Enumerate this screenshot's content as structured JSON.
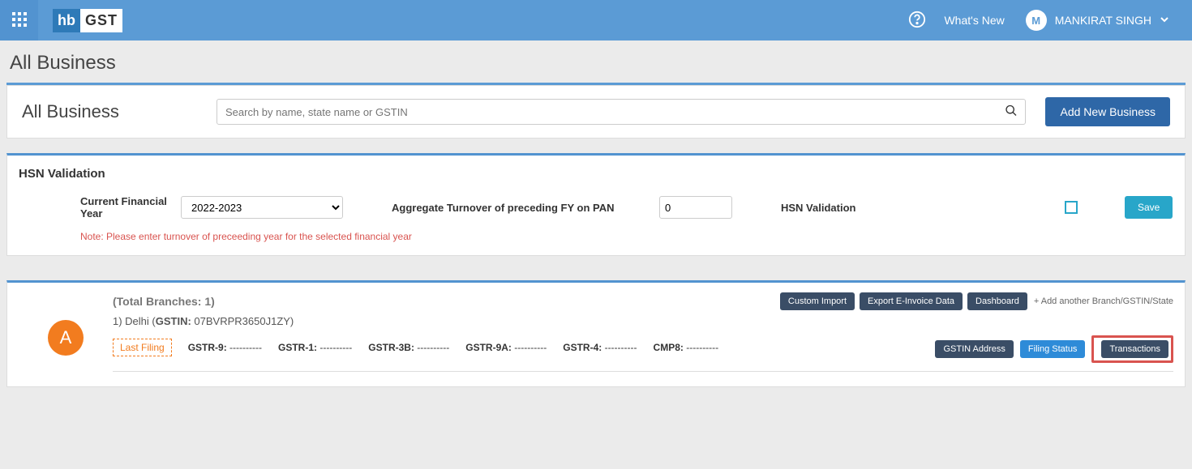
{
  "topbar": {
    "logo_hb": "hb",
    "logo_gst": "GST",
    "whats_new": "What's New",
    "user_initial": "M",
    "user_name": "MANKIRAT SINGH"
  },
  "page": {
    "title": "All Business"
  },
  "business_bar": {
    "label": "All Business",
    "search_placeholder": "Search by name, state name or GSTIN",
    "add_button": "Add New Business"
  },
  "hsn": {
    "title": "HSN Validation",
    "fy_label": "Current Financial Year",
    "fy_value": "2022-2023",
    "turnover_label": "Aggregate Turnover of preceding FY on PAN",
    "turnover_value": "0",
    "validation_label": "HSN Validation",
    "save_label": "Save",
    "note": "Note: Please enter turnover of preceeding year for the selected financial year"
  },
  "biz": {
    "branches_label": "(Total Branches: 1)",
    "buttons": {
      "custom_import": "Custom Import",
      "export_einvoice": "Export E-Invoice Data",
      "dashboard": "Dashboard",
      "add_branch": "+ Add another Branch/GSTIN/State"
    },
    "avatar_letter": "A",
    "row": {
      "prefix": "1) Delhi (",
      "gstin_label": "GSTIN:",
      "gstin_value": " 07BVRPR3650J1ZY)",
      "last_filing": "Last Filing",
      "filings": {
        "gstr9": {
          "label": "GSTR-9:",
          "value": " ----------"
        },
        "gstr1": {
          "label": "GSTR-1:",
          "value": " ----------"
        },
        "gstr3b": {
          "label": "GSTR-3B:",
          "value": " ----------"
        },
        "gstr9a": {
          "label": "GSTR-9A:",
          "value": " ----------"
        },
        "gstr4": {
          "label": "GSTR-4:",
          "value": " ----------"
        },
        "cmp8": {
          "label": "CMP8:",
          "value": " ----------"
        }
      }
    },
    "actions": {
      "gstin_address": "GSTIN Address",
      "filing_status": "Filing Status",
      "transactions": "Transactions"
    }
  }
}
